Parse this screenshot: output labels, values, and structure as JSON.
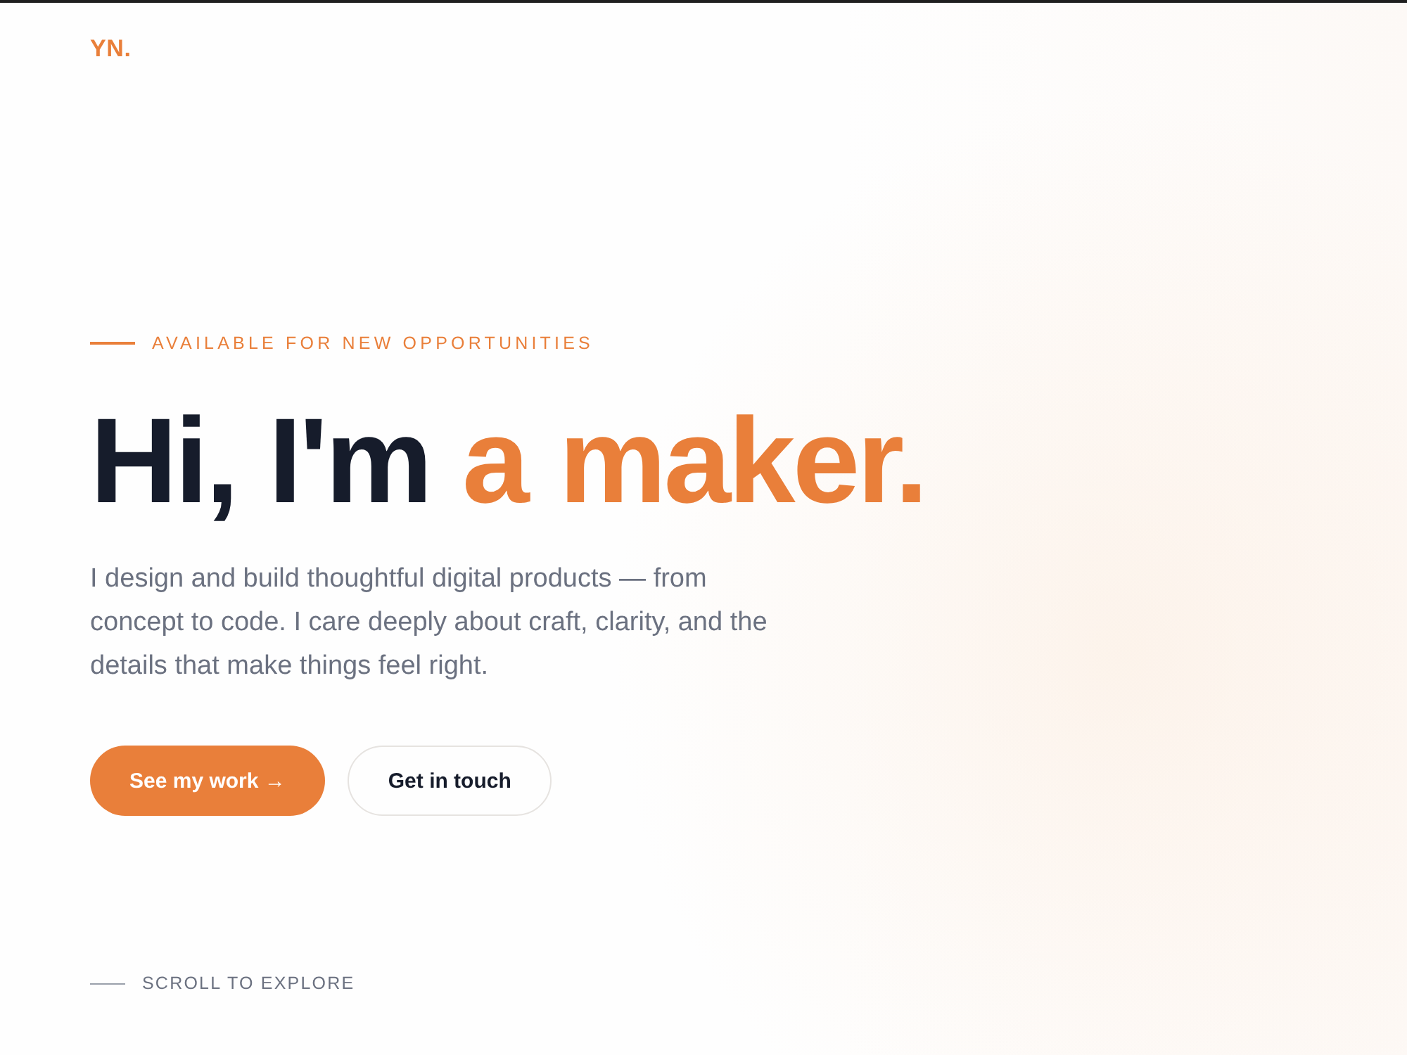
{
  "logo": "YN.",
  "hero": {
    "eyebrow": "AVAILABLE FOR NEW OPPORTUNITIES",
    "heading": {
      "lead": "Hi, I'm",
      "highlight": "a maker."
    },
    "intro": "I design and build thoughtful digital products — from concept to code. I care deeply about craft, clarity, and the details that make things feel right.",
    "buttons": [
      {
        "label": "See my work →",
        "kind": "primary"
      },
      {
        "label": "Get in touch",
        "kind": "secondary"
      }
    ]
  },
  "scroll_hint": "SCROLL TO EXPLORE"
}
